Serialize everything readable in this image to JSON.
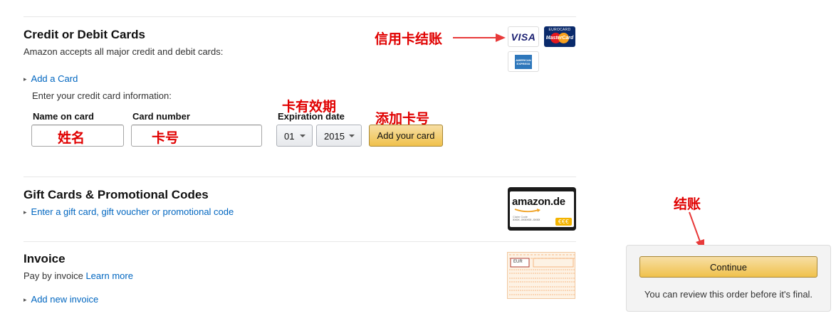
{
  "payment": {
    "credit": {
      "title": "Credit or Debit Cards",
      "subtitle": "Amazon accepts all major credit and debit cards:",
      "add_card_link": "Add a Card",
      "enter_info": "Enter your credit card information:",
      "name_label": "Name on card",
      "number_label": "Card number",
      "expiry_label": "Expiration date",
      "month_value": "01",
      "year_value": "2015",
      "add_button": "Add your card",
      "cards": {
        "visa": "VISA",
        "mastercard_top": "EUROCARD",
        "mastercard_text": "MasterCard",
        "amex": "AMERICAN EXPRESS"
      }
    },
    "gift": {
      "title": "Gift Cards & Promotional Codes",
      "link": "Enter a gift card, gift voucher or promotional code",
      "card_brand": "amazon.de",
      "card_small": "Claim Code",
      "card_code": "XXXX-XXXXXX-XXXX",
      "card_badge": "€€€"
    },
    "invoice": {
      "title": "Invoice",
      "pay_by": "Pay by invoice",
      "learn_more": "Learn more",
      "add_link": "Add new invoice",
      "form_currency": "EUR"
    }
  },
  "sidebar": {
    "continue_button": "Continue",
    "review_note": "You can review this order before it's final."
  },
  "annotations": {
    "credit_checkout": "信用卡结账",
    "expiry": "卡有效期",
    "add_card": "添加卡号",
    "name": "姓名",
    "number": "卡号",
    "checkout": "结账"
  },
  "colors": {
    "link": "#0066c0",
    "annotation": "#e00000",
    "button_yellow": "#f0c14b"
  }
}
